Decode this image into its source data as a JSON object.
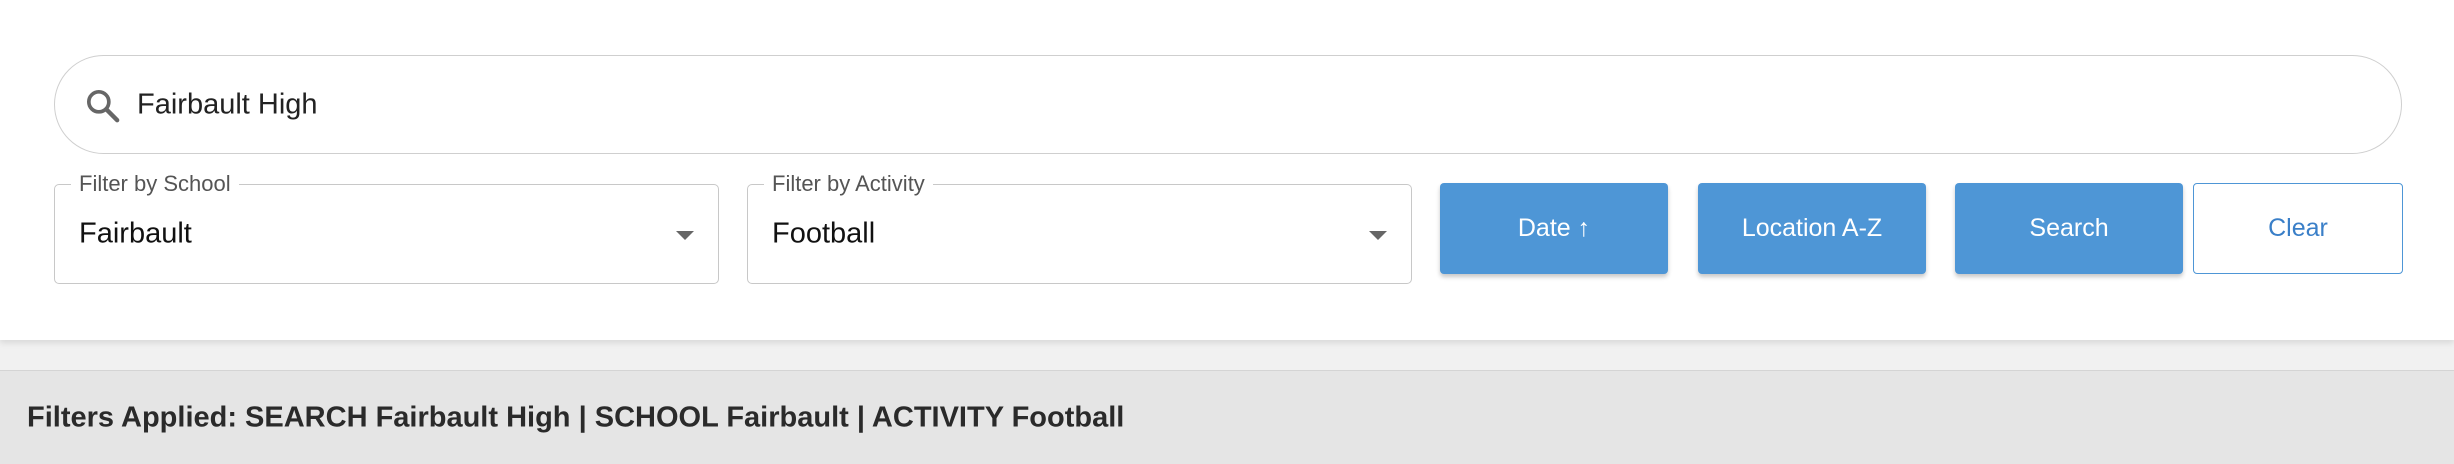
{
  "search": {
    "value": "Fairbault High",
    "icon": "search-icon"
  },
  "filters": {
    "school": {
      "label": "Filter by School",
      "value": "Fairbault"
    },
    "activity": {
      "label": "Filter by Activity",
      "value": "Football"
    }
  },
  "buttons": {
    "date": "Date ↑",
    "location": "Location A-Z",
    "search": "Search",
    "clear": "Clear"
  },
  "applied": {
    "text": "Filters Applied: SEARCH Fairbault High | SCHOOL Fairbault | ACTIVITY Football"
  },
  "colors": {
    "accent": "#4e96d6",
    "panel_background": "#ffffff",
    "filters_bar_background": "#e5e5e5"
  }
}
